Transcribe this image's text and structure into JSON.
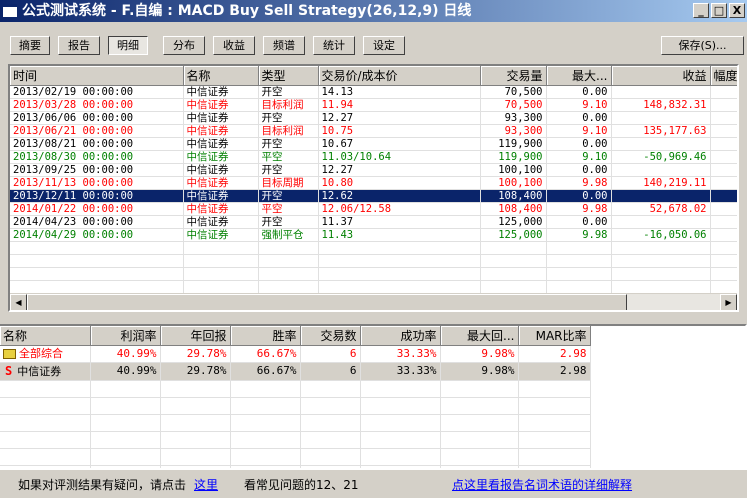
{
  "title": "公式测试系统 - F.自编 : MACD Buy Sell Strategy(26,12,9) 日线",
  "window_buttons": [
    "_",
    "□",
    "X"
  ],
  "tabs": [
    "摘要",
    "报告",
    "明细",
    "分布",
    "收益",
    "频谱",
    "统计",
    "设定"
  ],
  "active_tab": "明细",
  "save_label": "保存(S)...",
  "detail": {
    "columns": [
      "时间",
      "名称",
      "类型",
      "交易价/成本价",
      "交易量",
      "最大...",
      "收益",
      "幅度"
    ],
    "rows": [
      {
        "c": "black",
        "v": [
          "2013/02/19 00:00:00",
          "中信证券",
          "开空",
          "14.13",
          "70,500",
          "0.00",
          "",
          ""
        ]
      },
      {
        "c": "red",
        "v": [
          "2013/03/28 00:00:00",
          "中信证券",
          "目标利润",
          "11.94",
          "70,500",
          "9.10",
          "148,832.31",
          ""
        ]
      },
      {
        "c": "black",
        "v": [
          "2013/06/06 00:00:00",
          "中信证券",
          "开空",
          "12.27",
          "93,300",
          "0.00",
          "",
          ""
        ]
      },
      {
        "c": "red",
        "v": [
          "2013/06/21 00:00:00",
          "中信证券",
          "目标利润",
          "10.75",
          "93,300",
          "9.10",
          "135,177.63",
          ""
        ]
      },
      {
        "c": "black",
        "v": [
          "2013/08/21 00:00:00",
          "中信证券",
          "开空",
          "10.67",
          "119,900",
          "0.00",
          "",
          ""
        ]
      },
      {
        "c": "green",
        "v": [
          "2013/08/30 00:00:00",
          "中信证券",
          "平空",
          "11.03/10.64",
          "119,900",
          "9.10",
          "-50,969.46",
          ""
        ]
      },
      {
        "c": "black",
        "v": [
          "2013/09/25 00:00:00",
          "中信证券",
          "开空",
          "12.27",
          "100,100",
          "0.00",
          "",
          ""
        ]
      },
      {
        "c": "red",
        "v": [
          "2013/11/13 00:00:00",
          "中信证券",
          "目标周期",
          "10.80",
          "100,100",
          "9.98",
          "140,219.11",
          ""
        ]
      },
      {
        "c": "sel",
        "v": [
          "2013/12/11 00:00:00",
          "中信证券",
          "开空",
          "12.62",
          "108,400",
          "0.00",
          "",
          ""
        ]
      },
      {
        "c": "red",
        "v": [
          "2014/01/22 00:00:00",
          "中信证券",
          "平空",
          "12.06/12.58",
          "108,400",
          "9.98",
          "52,678.02",
          ""
        ]
      },
      {
        "c": "black",
        "v": [
          "2014/04/23 00:00:00",
          "中信证券",
          "开空",
          "11.37",
          "125,000",
          "0.00",
          "",
          ""
        ]
      },
      {
        "c": "green",
        "v": [
          "2014/04/29 00:00:00",
          "中信证券",
          "强制平仓",
          "11.43",
          "125,000",
          "9.98",
          "-16,050.06",
          ""
        ]
      }
    ]
  },
  "summary": {
    "columns": [
      "名称",
      "利润率",
      "年回报",
      "胜率",
      "交易数",
      "成功率",
      "最大回...",
      "MAR比率"
    ],
    "rows": [
      {
        "c": "red",
        "icon": "folder-icon",
        "v": [
          "全部综合",
          "40.99%",
          "29.78%",
          "66.67%",
          "6",
          "33.33%",
          "9.98%",
          "2.98"
        ]
      },
      {
        "c": "black",
        "icon": "stock-s-icon",
        "v": [
          "中信证券",
          "40.99%",
          "29.78%",
          "66.67%",
          "6",
          "33.33%",
          "9.98%",
          "2.98"
        ]
      }
    ]
  },
  "status": {
    "text1": "如果对评测结果有疑问，请点击",
    "link1": "这里",
    "text2": "看常见问题的12、21",
    "link2": "点这里看报告名词术语的详细解释"
  }
}
